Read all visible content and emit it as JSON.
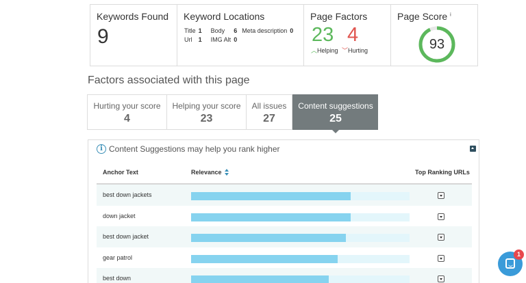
{
  "stats": {
    "keywords_found": {
      "title": "Keywords Found",
      "value": "9"
    },
    "keyword_locations": {
      "title": "Keyword Locations",
      "items": [
        {
          "label": "Title",
          "value": "1"
        },
        {
          "label": "Body",
          "value": "6"
        },
        {
          "label": "Meta description",
          "value": "0"
        },
        {
          "label": "Url",
          "value": "1"
        },
        {
          "label": "IMG Alt",
          "value": "0"
        }
      ]
    },
    "page_factors": {
      "title": "Page Factors",
      "helping": "23",
      "hurting": "4",
      "helping_label": "Helping",
      "hurting_label": "Hurting"
    },
    "page_score": {
      "title": "Page Score",
      "info_mark": "i",
      "value": "93",
      "score_fraction": 0.93,
      "ring_color": "#5cb85c"
    }
  },
  "section_title": "Factors associated with this page",
  "tabs": [
    {
      "label": "Hurting your score",
      "count": "4"
    },
    {
      "label": "Helping your score",
      "count": "23"
    },
    {
      "label": "All issues",
      "count": "27"
    },
    {
      "label": "Content suggestions",
      "count": "25",
      "active": true
    }
  ],
  "suggestions": {
    "info_text": "Content Suggestions may help you rank higher",
    "columns": {
      "anchor": "Anchor Text",
      "relevance": "Relevance",
      "urls": "Top Ranking URLs"
    },
    "rows": [
      {
        "anchor": "best down jackets",
        "relevance": 0.73
      },
      {
        "anchor": "down jacket",
        "relevance": 0.73
      },
      {
        "anchor": "best down jacket",
        "relevance": 0.71
      },
      {
        "anchor": "gear patrol",
        "relevance": 0.67
      },
      {
        "anchor": "best down",
        "relevance": 0.63
      }
    ]
  },
  "chat": {
    "badge": "1"
  },
  "colors": {
    "accent_blue": "#3a8fb7",
    "bar_fill": "#86d3ef",
    "bar_track": "#e3f6fb",
    "active_tab": "#737b7d",
    "helping_green": "#5cb85c",
    "hurting_red": "#e0554f"
  }
}
